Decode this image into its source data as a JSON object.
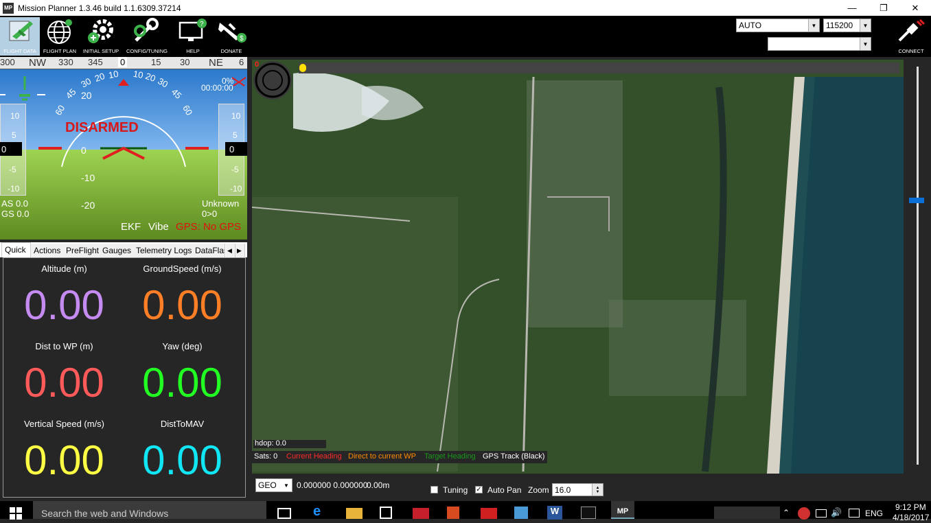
{
  "window": {
    "title": "Mission Planner 1.3.46 build 1.1.6309.37214",
    "logo": "MP"
  },
  "menu": [
    {
      "label": "FLIGHT DATA",
      "icon": "flight-data-icon"
    },
    {
      "label": "FLIGHT PLAN",
      "icon": "globe-icon"
    },
    {
      "label": "INITIAL SETUP",
      "icon": "gear-icon"
    },
    {
      "label": "CONFIG/TUNING",
      "icon": "wrench-icon"
    },
    {
      "label": "HELP",
      "icon": "help-monitor-icon"
    },
    {
      "label": "DONATE",
      "icon": "donate-plane-icon"
    }
  ],
  "connection": {
    "mode": "AUTO",
    "baud": "115200",
    "port": "",
    "connect_label": "CONNECT"
  },
  "hud": {
    "compass": [
      "300",
      "NW",
      "330",
      "345",
      "0",
      "15",
      "30",
      "NE",
      "6"
    ],
    "status": "DISARMED",
    "timer": "00:00:00",
    "pct": "0%",
    "pitch_labels": [
      "20",
      "10",
      "0",
      "-10",
      "-20"
    ],
    "roll_labels": [
      "60",
      "45",
      "30",
      "20",
      "10",
      "0",
      "10",
      "20",
      "30",
      "45",
      "60"
    ],
    "left_tape": [
      "10",
      "5",
      "0",
      "-5",
      "-10"
    ],
    "right_tape": [
      "10",
      "5",
      "0",
      "-5",
      "-10"
    ],
    "airspeed": "AS 0.0",
    "groundspeed": "GS 0.0",
    "mode": "Unknown",
    "wp": "0>0",
    "ekf": "EKF",
    "vibe": "Vibe",
    "gps": "GPS: No GPS"
  },
  "tabs": [
    "Quick",
    "Actions",
    "PreFlight",
    "Gauges",
    "Telemetry Logs",
    "DataFlas"
  ],
  "quick": [
    {
      "label": "Altitude (m)",
      "value": "0.00",
      "color": "#c58bf0"
    },
    {
      "label": "GroundSpeed (m/s)",
      "value": "0.00",
      "color": "#ff7f27"
    },
    {
      "label": "Dist to WP (m)",
      "value": "0.00",
      "color": "#ff5a5a"
    },
    {
      "label": "Yaw (deg)",
      "value": "0.00",
      "color": "#22ff22"
    },
    {
      "label": "Vertical Speed (m/s)",
      "value": "0.00",
      "color": "#ffff44"
    },
    {
      "label": "DistToMAV",
      "value": "0.00",
      "color": "#11e6f5"
    }
  ],
  "map": {
    "red_marker": "0",
    "hdop": "hdop: 0.0",
    "sats": "Sats: 0",
    "legend": [
      {
        "text": "Current Heading",
        "color": "#ff2a2a"
      },
      {
        "text": "Direct to current WP",
        "color": "#ff8c00"
      },
      {
        "text": "Target Heading",
        "color": "#1a9a1a"
      },
      {
        "text": "GPS Track (Black)",
        "color": "#ffffff"
      }
    ]
  },
  "map_bottom": {
    "coord_system": "GEO",
    "coords": "0.000000 0.000000",
    "alt": "0.00m",
    "tuning_label": "Tuning",
    "tuning_checked": false,
    "autopan_label": "Auto Pan",
    "autopan_checked": true,
    "zoom_label": "Zoom",
    "zoom_value": "16.0"
  },
  "taskbar": {
    "search_placeholder": "Search the web and Windows",
    "time": "9:12 PM",
    "date": "4/18/2017",
    "lang": "ENG"
  }
}
